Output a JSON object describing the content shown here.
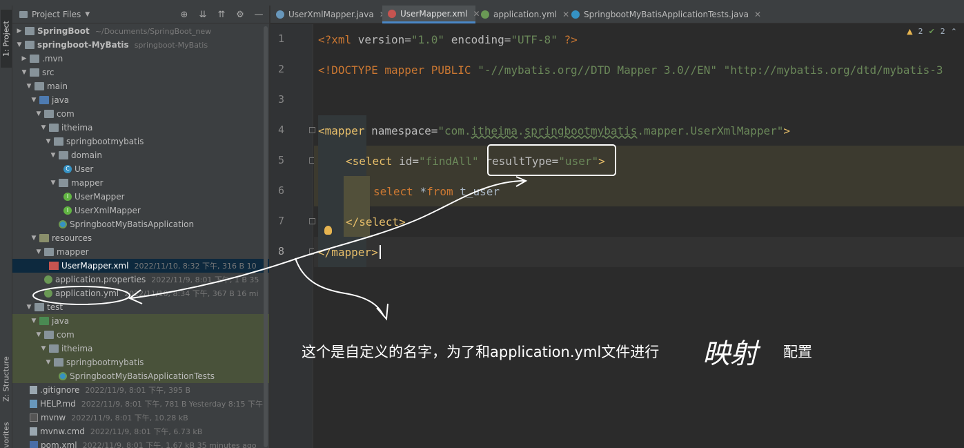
{
  "side_tabs": {
    "project": "1: Project",
    "structure": "Z: Structure",
    "favorites": "vorites"
  },
  "project_panel": {
    "title": "Project Files",
    "tools": [
      "target-icon",
      "expand-all-icon",
      "collapse-all-icon",
      "gear-icon",
      "minimize-icon"
    ],
    "tree": [
      {
        "label": "SpringBoot",
        "meta": "~/Documents/SpringBoot_new",
        "bold": true
      },
      {
        "label": "springboot-MyBatis",
        "meta": "springboot-MyBatis",
        "bold": true
      },
      {
        "label": ".mvn",
        "meta": ""
      },
      {
        "label": "src",
        "meta": ""
      },
      {
        "label": "main",
        "meta": ""
      },
      {
        "label": "java",
        "meta": ""
      },
      {
        "label": "com",
        "meta": ""
      },
      {
        "label": "itheima",
        "meta": ""
      },
      {
        "label": "springbootmybatis",
        "meta": ""
      },
      {
        "label": "domain",
        "meta": ""
      },
      {
        "label": "User",
        "meta": ""
      },
      {
        "label": "mapper",
        "meta": ""
      },
      {
        "label": "UserMapper",
        "meta": ""
      },
      {
        "label": "UserXmlMapper",
        "meta": ""
      },
      {
        "label": "SpringbootMyBatisApplication",
        "meta": ""
      },
      {
        "label": "resources",
        "meta": ""
      },
      {
        "label": "mapper",
        "meta": ""
      },
      {
        "label": "UserMapper.xml",
        "meta": "2022/11/10, 8:32 下午, 316 B 10"
      },
      {
        "label": "application.properties",
        "meta": "2022/11/9, 8:01 下午, 1 B 35"
      },
      {
        "label": "application.yml",
        "meta": "2022/11/10, 8:34 下午, 367 B 16 mi"
      },
      {
        "label": "test",
        "meta": ""
      },
      {
        "label": "java",
        "meta": ""
      },
      {
        "label": "com",
        "meta": ""
      },
      {
        "label": "itheima",
        "meta": ""
      },
      {
        "label": "springbootmybatis",
        "meta": ""
      },
      {
        "label": "SpringbootMyBatisApplicationTests",
        "meta": ""
      },
      {
        "label": ".gitignore",
        "meta": "2022/11/9, 8:01 下午, 395 B"
      },
      {
        "label": "HELP.md",
        "meta": "2022/11/9, 8:01 下午, 781 B Yesterday 8:15 下午"
      },
      {
        "label": "mvnw",
        "meta": "2022/11/9, 8:01 下午, 10.28 kB"
      },
      {
        "label": "mvnw.cmd",
        "meta": "2022/11/9, 8:01 下午, 6.73 kB"
      },
      {
        "label": "pom.xml",
        "meta": "2022/11/9, 8:01 下午, 1.67 kB 35 minutes ago"
      }
    ]
  },
  "editor_tabs": [
    {
      "label": "UserXmlMapper.java",
      "active": false
    },
    {
      "label": "UserMapper.xml",
      "active": true
    },
    {
      "label": "application.yml",
      "active": false
    },
    {
      "label": "SpringbootMyBatisApplicationTests.java",
      "active": false
    }
  ],
  "inspection": {
    "warnings": "2",
    "weak_warnings": "2"
  },
  "code": {
    "line_numbers": [
      "1",
      "2",
      "3",
      "4",
      "5",
      "6",
      "7",
      "8"
    ],
    "l1": {
      "a": "<?xml ",
      "b": "version",
      "c": "=",
      "d": "\"1.0\"",
      "e": " ",
      "f": "encoding",
      "g": "=",
      "h": "\"UTF-8\"",
      "i": " ?>"
    },
    "l2": {
      "a": "<!DOCTYPE mapper PUBLIC ",
      "b": "\"-//mybatis.org//DTD Mapper 3.0//EN\"",
      "c": " ",
      "d": "\"http://mybatis.org/dtd/mybatis-3"
    },
    "l4": {
      "a": "<mapper",
      "b": " namespace",
      "c": "=",
      "d": "\"com.",
      "e": "itheima",
      "f": ".",
      "g": "springbootmybatis",
      "h": ".mapper.UserXmlMapper\"",
      "i": ">"
    },
    "l5": {
      "a": "<select",
      "b": " id",
      "c": "=",
      "d": "\"findAll\"",
      "e": " resultType",
      "f": "=",
      "g": "\"user\"",
      "h": ">"
    },
    "l6": {
      "a": "select ",
      "b": "*",
      "c": "from",
      "d": " t_user"
    },
    "l7": {
      "a": "</select>"
    },
    "l8": {
      "a": "</mapper>"
    }
  },
  "annotation": {
    "text": "这个是自定义的名字，为了和application.yml文件进行",
    "handwritten": "映射",
    "tail": "配置"
  },
  "colors": {
    "tag": "#e8bf6a",
    "value": "#6a8759",
    "keyword": "#cc7832",
    "selection": "#0d293e",
    "active_tab_underline": "#4a88c7"
  }
}
